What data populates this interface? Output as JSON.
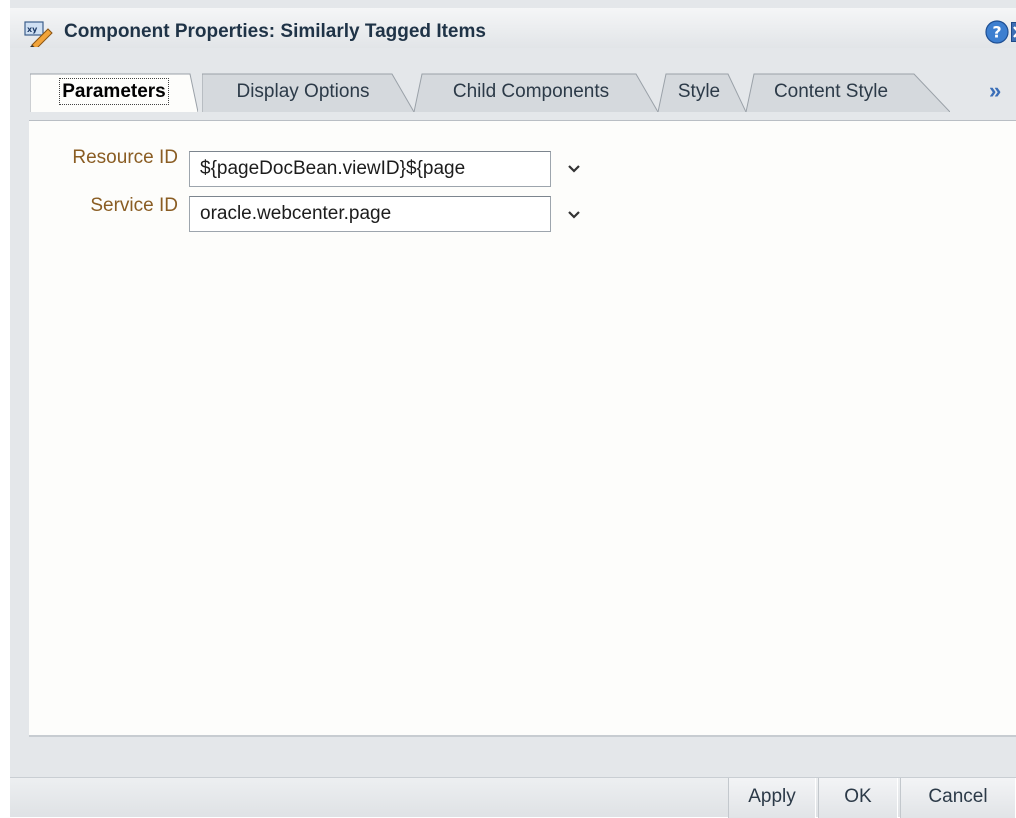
{
  "title": "Component Properties: Similarly Tagged Items",
  "icons": {
    "title": "edit-properties-icon",
    "help": "help-icon",
    "close": "close-icon",
    "more_tabs": "double-chevron-right-icon",
    "dropdown": "chevron-down-icon"
  },
  "tabs": [
    {
      "label": "Parameters",
      "active": true
    },
    {
      "label": "Display Options",
      "active": false
    },
    {
      "label": "Child Components",
      "active": false
    },
    {
      "label": "Style",
      "active": false
    },
    {
      "label": "Content Style",
      "active": false
    }
  ],
  "more_tabs": "»",
  "fields": [
    {
      "label": "Resource ID",
      "value": "${pageDocBean.viewID}${page"
    },
    {
      "label": "Service ID",
      "value": "oracle.webcenter.page"
    }
  ],
  "buttons": {
    "apply": "Apply",
    "ok": "OK",
    "cancel": "Cancel"
  },
  "colors": {
    "label": "#8a5d23",
    "accent": "#3b6fb8",
    "chrome": "#e4e7ea",
    "panel": "#fdfdfb"
  }
}
